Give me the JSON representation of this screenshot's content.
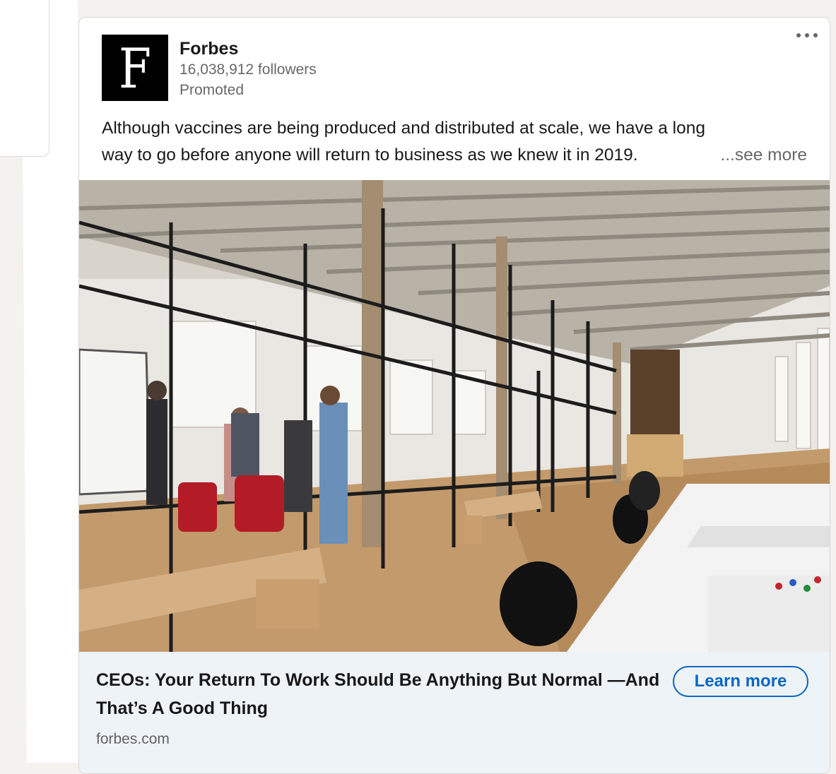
{
  "post": {
    "company_name": "Forbes",
    "logo_letter": "F",
    "followers": "16,038,912 followers",
    "status": "Promoted",
    "menu_icon": "more-horizontal-icon",
    "text_line1": "Although vaccines are being produced and distributed at scale, we have a long",
    "text_line2": "way to go before anyone will return to business as we knew it in 2019.",
    "see_more": "...see more",
    "image_description": "office-interior-photo",
    "headline": "CEOs: Your Return To Work Should Be Anything But Normal —And That’s A Good Thing",
    "domain": "forbes.com",
    "cta_label": "Learn more"
  },
  "colors": {
    "accent": "#0a66c2",
    "page_background": "#f4f2ee",
    "footer_background": "#eef3f8"
  }
}
